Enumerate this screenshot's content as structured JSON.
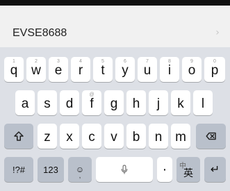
{
  "suggestion": {
    "text": "EVSE8688",
    "chevron": "›"
  },
  "keyboard": {
    "row1": [
      {
        "label": "q",
        "hint": "1"
      },
      {
        "label": "w",
        "hint": "2"
      },
      {
        "label": "e",
        "hint": "3"
      },
      {
        "label": "r",
        "hint": "4"
      },
      {
        "label": "t",
        "hint": "5"
      },
      {
        "label": "y",
        "hint": "6"
      },
      {
        "label": "u",
        "hint": "7"
      },
      {
        "label": "i",
        "hint": "8"
      },
      {
        "label": "o",
        "hint": "9"
      },
      {
        "label": "p",
        "hint": "0"
      }
    ],
    "row2": [
      {
        "label": "a",
        "hint": ""
      },
      {
        "label": "s",
        "hint": ""
      },
      {
        "label": "d",
        "hint": ""
      },
      {
        "label": "f",
        "hint": "@"
      },
      {
        "label": "g",
        "hint": ""
      },
      {
        "label": "h",
        "hint": ""
      },
      {
        "label": "j",
        "hint": ""
      },
      {
        "label": "k",
        "hint": ""
      },
      {
        "label": "l",
        "hint": ""
      }
    ],
    "row3": [
      {
        "label": "z",
        "hint": ""
      },
      {
        "label": "x",
        "hint": ""
      },
      {
        "label": "c",
        "hint": ""
      },
      {
        "label": "v",
        "hint": ""
      },
      {
        "label": "b",
        "hint": ""
      },
      {
        "label": "n",
        "hint": ""
      },
      {
        "label": "m",
        "hint": ""
      }
    ],
    "bottom": {
      "symbols_label": "!?#",
      "numbers_label": "123",
      "emoji_label": "☺",
      "comma_label": ",",
      "space_label": "",
      "period_label": "·",
      "lang_label": "英",
      "lang_hint": "中",
      "enter_label": "↵"
    },
    "icons": {
      "shift": "shift-icon",
      "backspace": "backspace-icon",
      "mic": "microphone-icon"
    }
  },
  "colors": {
    "key_bg": "#ffffff",
    "key_dark_bg": "#b9c0cb",
    "keyboard_bg": "#dde0e6",
    "dot": "#f06a3a"
  }
}
